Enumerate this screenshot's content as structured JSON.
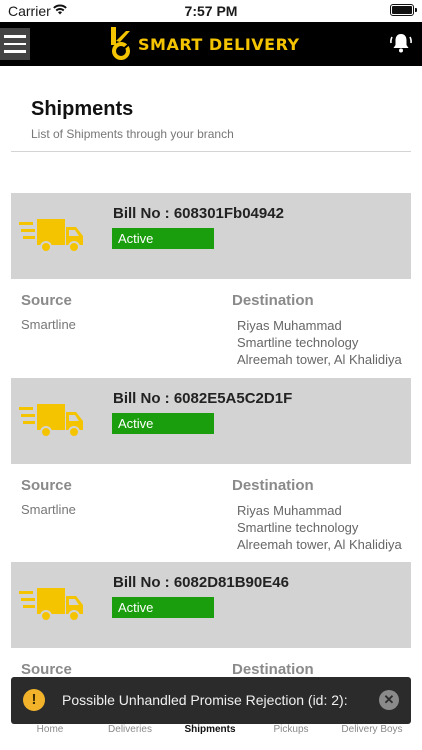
{
  "status_bar": {
    "carrier": "Carrier",
    "time": "7:57 PM"
  },
  "header": {
    "brand": "SMART DELIVERY",
    "icons": [
      "menu-icon",
      "logo",
      "bell-icon"
    ],
    "brand_color": "#f5c400"
  },
  "page": {
    "title": "Shipments",
    "subtitle": "List of Shipments through your branch"
  },
  "labels": {
    "source": "Source",
    "destination": "Destination"
  },
  "shipments": [
    {
      "bill": "Bill No : 608301Fb04942",
      "status": "Active",
      "source": "Smartline",
      "destination": [
        "Riyas Muhammad",
        "Smartline technology",
        "Alreemah tower, Al Khalidiya"
      ]
    },
    {
      "bill": "Bill No : 6082E5A5C2D1F",
      "status": "Active",
      "source": "Smartline",
      "destination": [
        "Riyas Muhammad",
        "Smartline technology",
        "Alreemah tower, Al Khalidiya"
      ]
    },
    {
      "bill": "Bill No : 6082D81B90E46",
      "status": "Active",
      "source": "",
      "destination": []
    }
  ],
  "toast": {
    "message": "Possible Unhandled Promise Rejection (id: 2):",
    "icon": "!"
  },
  "tabs": [
    {
      "label": "Home",
      "active": false
    },
    {
      "label": "Deliveries",
      "active": false
    },
    {
      "label": "Shipments",
      "active": true
    },
    {
      "label": "Pickups",
      "active": false
    },
    {
      "label": "Delivery Boys",
      "active": false
    }
  ],
  "colors": {
    "active_badge": "#1a9e0d",
    "truck": "#f5c400",
    "card_header": "#d3d3d3",
    "toast_bg": "#2b2b2b"
  }
}
